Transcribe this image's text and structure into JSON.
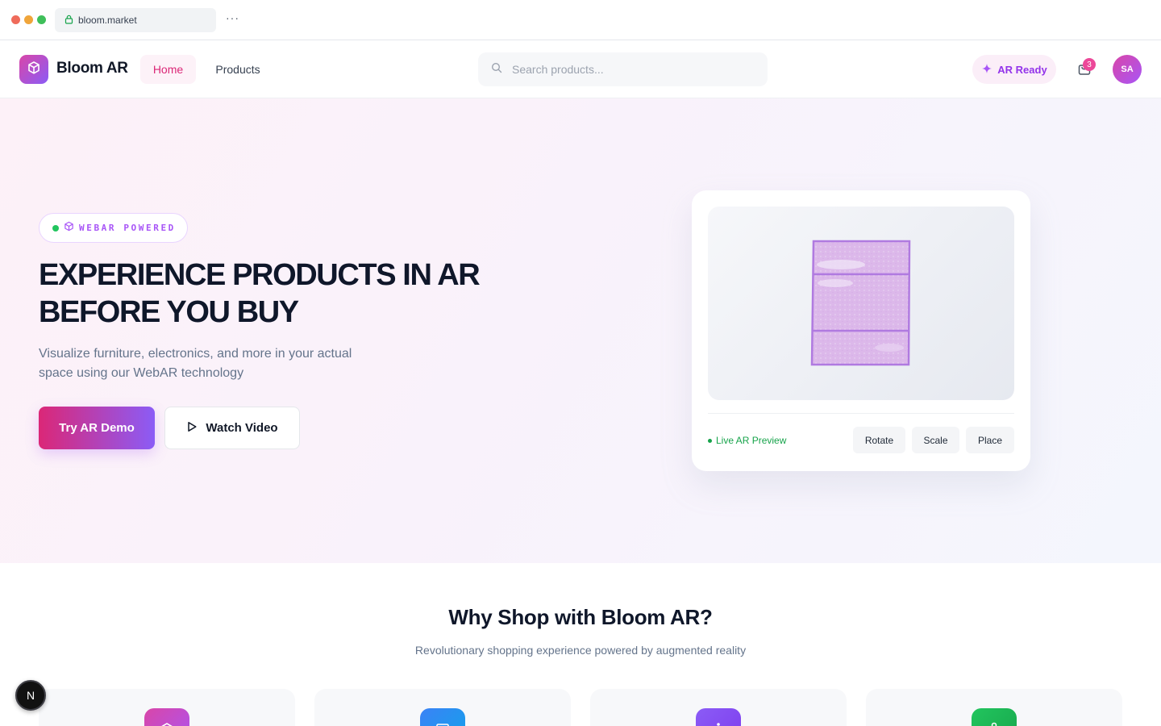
{
  "browser": {
    "url": "bloom.market",
    "more_label": "···"
  },
  "header": {
    "brand": "Bloom AR",
    "nav": {
      "home": "Home",
      "products": "Products"
    },
    "search_placeholder": "Search products...",
    "ar_ready": "AR Ready",
    "cart_count": "3",
    "avatar_initials": "SA"
  },
  "hero": {
    "badge": "WEBAR POWERED",
    "title": "Experience Products in AR Before You Buy",
    "subtitle": "Visualize furniture, electronics, and more in your actual space using our WebAR technology",
    "primary_button": "Try AR Demo",
    "secondary_button": "Watch Video",
    "preview": {
      "status": "Live AR Preview",
      "controls": {
        "rotate": "Rotate",
        "scale": "Scale",
        "place": "Place"
      }
    }
  },
  "features": {
    "title": "Why Shop with Bloom AR?",
    "subtitle": "Revolutionary shopping experience powered by augmented reality"
  },
  "devtools": {
    "badge": "N"
  },
  "colors": {
    "brand_pink": "#db2777",
    "brand_purple": "#8b5cf6",
    "live_green": "#16a34a",
    "feature_icon_1": "#d946a8",
    "feature_icon_2": "#3b82f6",
    "feature_icon_3": "#8b5cf6",
    "feature_icon_4": "#22c55e"
  }
}
